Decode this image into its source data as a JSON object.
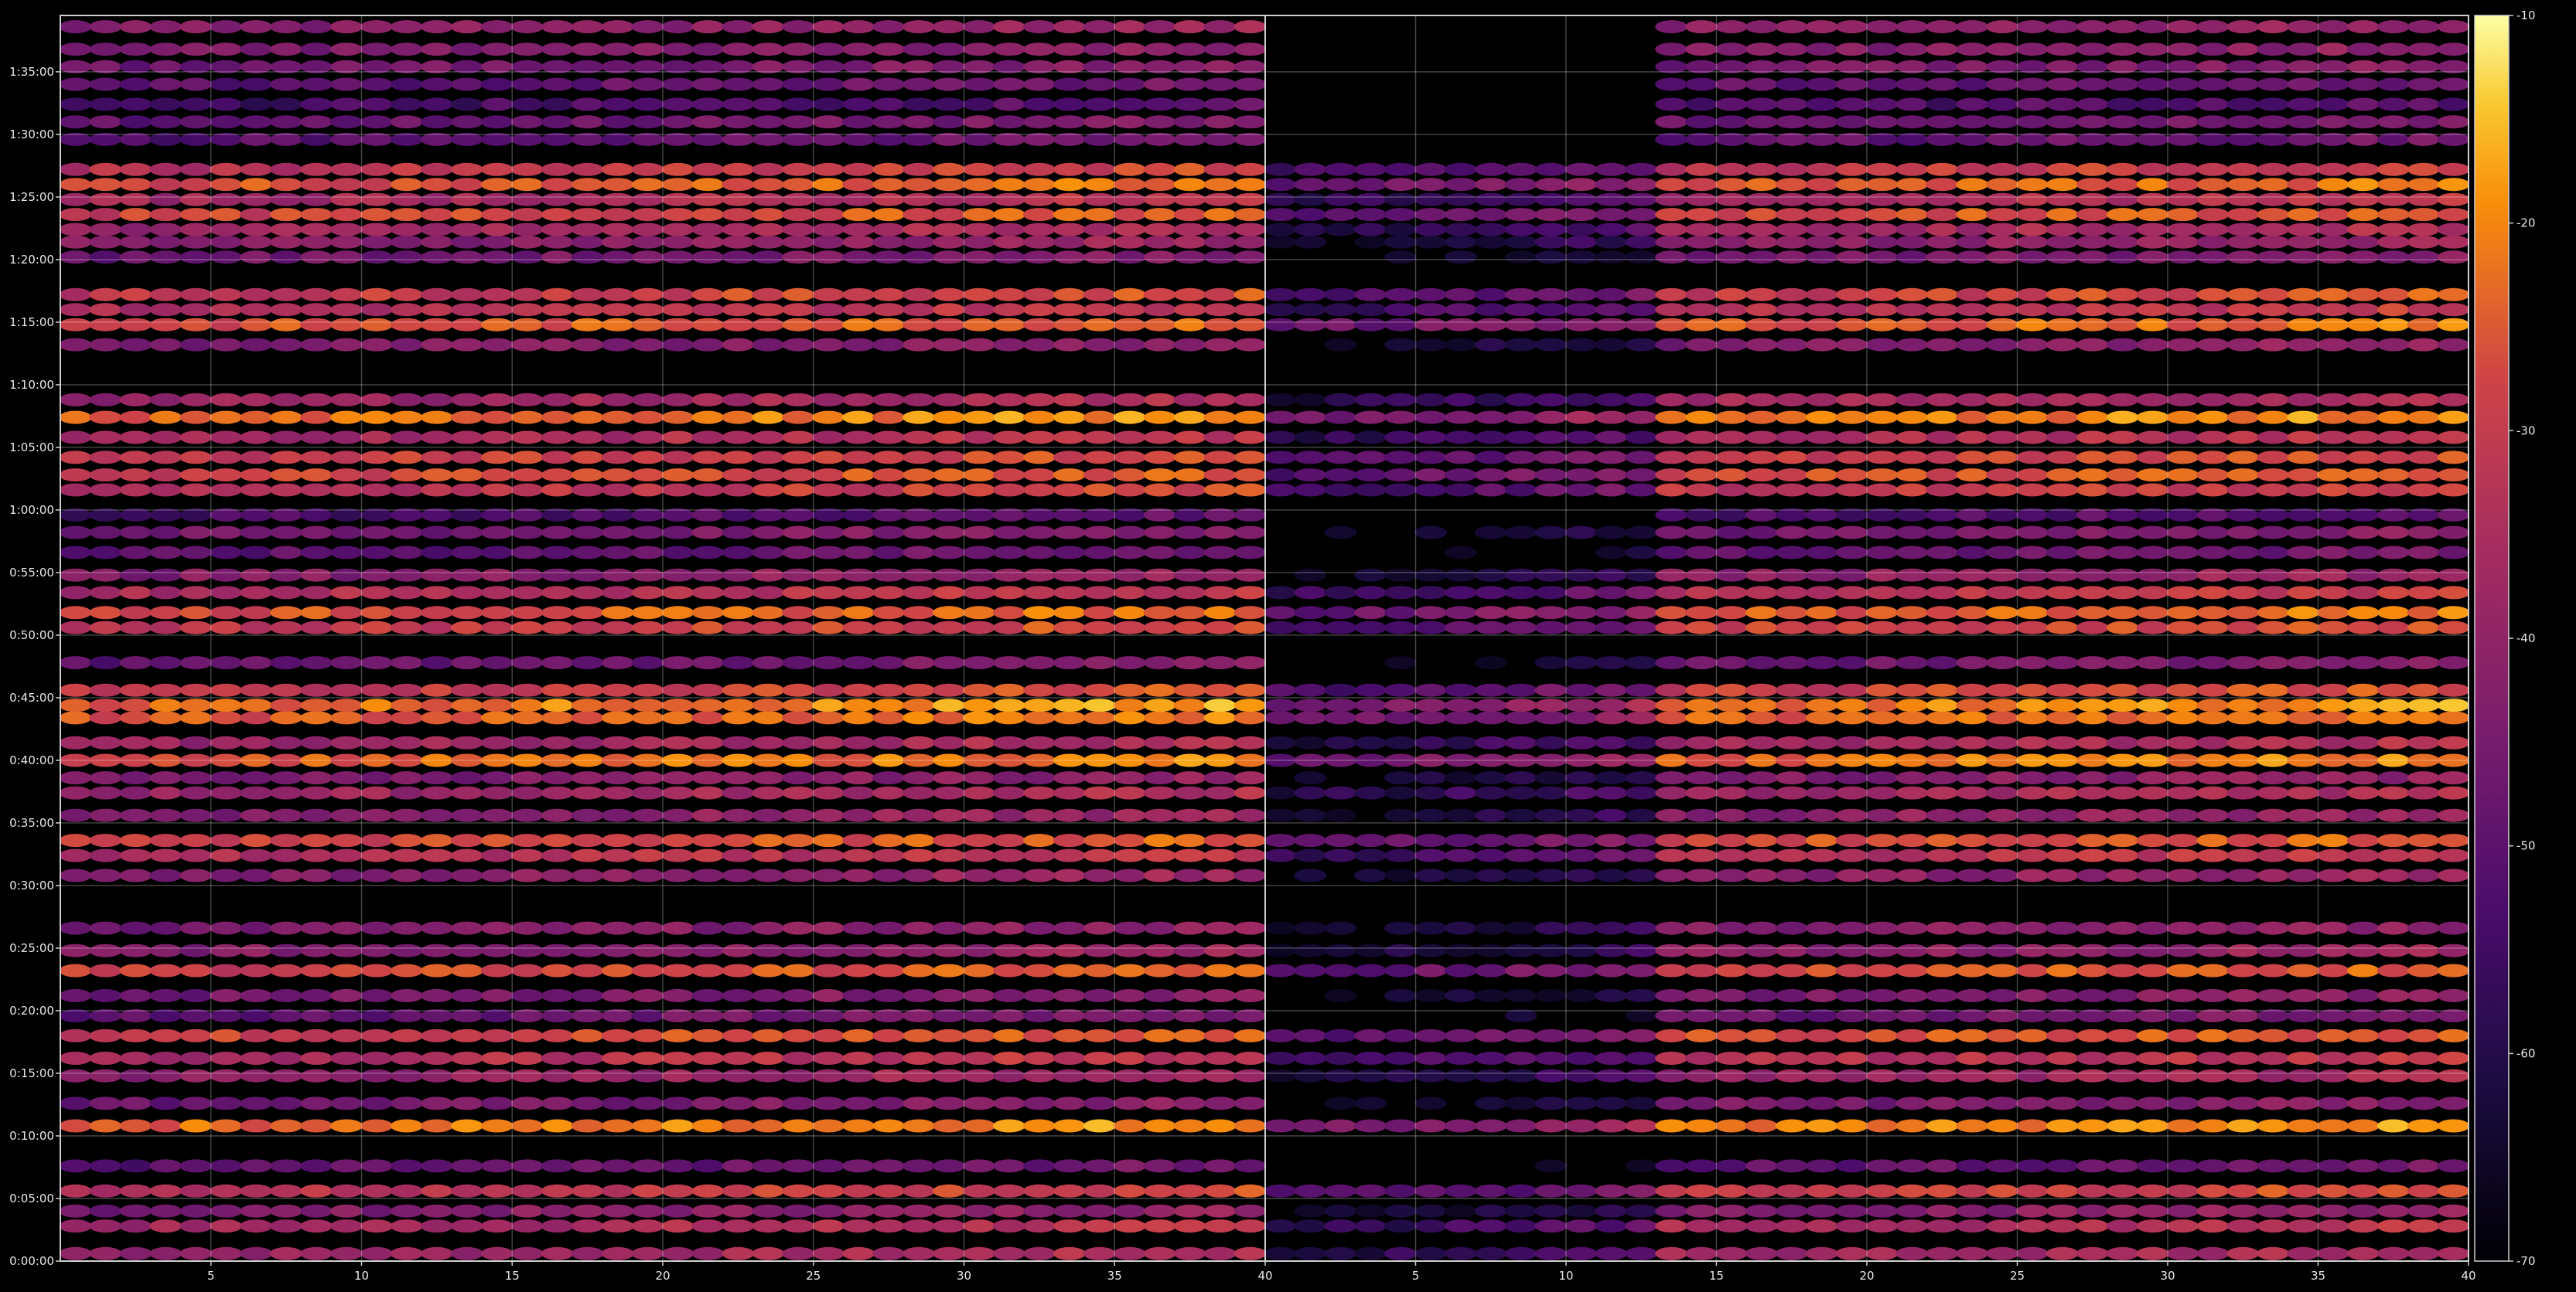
{
  "chart_data": [
    {
      "type": "heatmap",
      "panel": "left",
      "x_range": [
        1,
        40
      ],
      "x_ticks": [
        5,
        10,
        15,
        20,
        25,
        30,
        35,
        40
      ],
      "y_ticks": [
        "0:00:00",
        "0:05:00",
        "0:10:00",
        "0:15:00",
        "0:20:00",
        "0:25:00",
        "0:30:00",
        "0:35:00",
        "0:40:00",
        "0:45:00",
        "0:50:00",
        "0:55:00",
        "1:00:00",
        "1:05:00",
        "1:10:00",
        "1:15:00",
        "1:20:00",
        "1:25:00",
        "1:30:00",
        "1:35:00"
      ],
      "y_range_minutes": [
        0,
        99.5
      ],
      "grid": true,
      "colormap": "inferno",
      "bands": [
        {
          "minutes": 0.6,
          "level": -40
        },
        {
          "minutes": 2.8,
          "level": -38
        },
        {
          "minutes": 4.0,
          "level": -45
        },
        {
          "minutes": 5.6,
          "level": -33
        },
        {
          "minutes": 7.6,
          "level": -52
        },
        {
          "minutes": 10.8,
          "level": -24
        },
        {
          "minutes": 12.6,
          "level": -48
        },
        {
          "minutes": 14.8,
          "level": -42
        },
        {
          "minutes": 16.2,
          "level": -36
        },
        {
          "minutes": 18.0,
          "level": -30
        },
        {
          "minutes": 19.6,
          "level": -50
        },
        {
          "minutes": 21.2,
          "level": -47
        },
        {
          "minutes": 23.2,
          "level": -30
        },
        {
          "minutes": 24.8,
          "level": -44
        },
        {
          "minutes": 26.6,
          "level": -46
        },
        {
          "minutes": 30.8,
          "level": -44
        },
        {
          "minutes": 32.4,
          "level": -36
        },
        {
          "minutes": 33.6,
          "level": -30
        },
        {
          "minutes": 35.6,
          "level": -44
        },
        {
          "minutes": 37.4,
          "level": -40
        },
        {
          "minutes": 38.6,
          "level": -46
        },
        {
          "minutes": 40.0,
          "level": -26
        },
        {
          "minutes": 41.4,
          "level": -40
        },
        {
          "minutes": 43.4,
          "level": -27
        },
        {
          "minutes": 44.4,
          "level": -24
        },
        {
          "minutes": 45.6,
          "level": -32
        },
        {
          "minutes": 47.8,
          "level": -50
        },
        {
          "minutes": 50.6,
          "level": -32
        },
        {
          "minutes": 51.8,
          "level": -28
        },
        {
          "minutes": 53.4,
          "level": -36
        },
        {
          "minutes": 54.8,
          "level": -44
        },
        {
          "minutes": 56.6,
          "level": -52
        },
        {
          "minutes": 58.2,
          "level": -48
        },
        {
          "minutes": 59.6,
          "level": -55
        },
        {
          "minutes": 61.6,
          "level": -34
        },
        {
          "minutes": 62.8,
          "level": -30
        },
        {
          "minutes": 64.2,
          "level": -32
        },
        {
          "minutes": 65.8,
          "level": -38
        },
        {
          "minutes": 67.4,
          "level": -25
        },
        {
          "minutes": 68.8,
          "level": -40
        },
        {
          "minutes": 73.2,
          "level": -46
        },
        {
          "minutes": 74.8,
          "level": -28
        },
        {
          "minutes": 76.0,
          "level": -36
        },
        {
          "minutes": 77.2,
          "level": -32
        },
        {
          "minutes": 80.2,
          "level": -48
        },
        {
          "minutes": 81.4,
          "level": -44
        },
        {
          "minutes": 82.4,
          "level": -40
        },
        {
          "minutes": 83.6,
          "level": -30
        },
        {
          "minutes": 84.8,
          "level": -38
        },
        {
          "minutes": 86.0,
          "level": -28
        },
        {
          "minutes": 87.2,
          "level": -34
        },
        {
          "minutes": 89.6,
          "level": -52
        },
        {
          "minutes": 91.0,
          "level": -50
        },
        {
          "minutes": 92.4,
          "level": -56
        },
        {
          "minutes": 94.0,
          "level": -52
        },
        {
          "minutes": 95.4,
          "level": -48
        },
        {
          "minutes": 96.8,
          "level": -46
        },
        {
          "minutes": 98.6,
          "level": -44
        }
      ]
    },
    {
      "type": "heatmap",
      "panel": "right",
      "x_range": [
        1,
        40
      ],
      "x_ticks": [
        5,
        10,
        15,
        20,
        25,
        30,
        35,
        40
      ],
      "grid": true,
      "colormap": "inferno",
      "note_visible": "columns 1–13 dimmer than left panel; upper rows above 1:27 only from column 14"
    }
  ],
  "colorbar": {
    "min": -70,
    "max": -10,
    "ticks": [
      -10,
      -20,
      -30,
      -40,
      -50,
      -60,
      -70
    ]
  },
  "colors": {
    "background": "#000000",
    "frame": "#cfcfcf",
    "text": "#e8e8e8"
  }
}
